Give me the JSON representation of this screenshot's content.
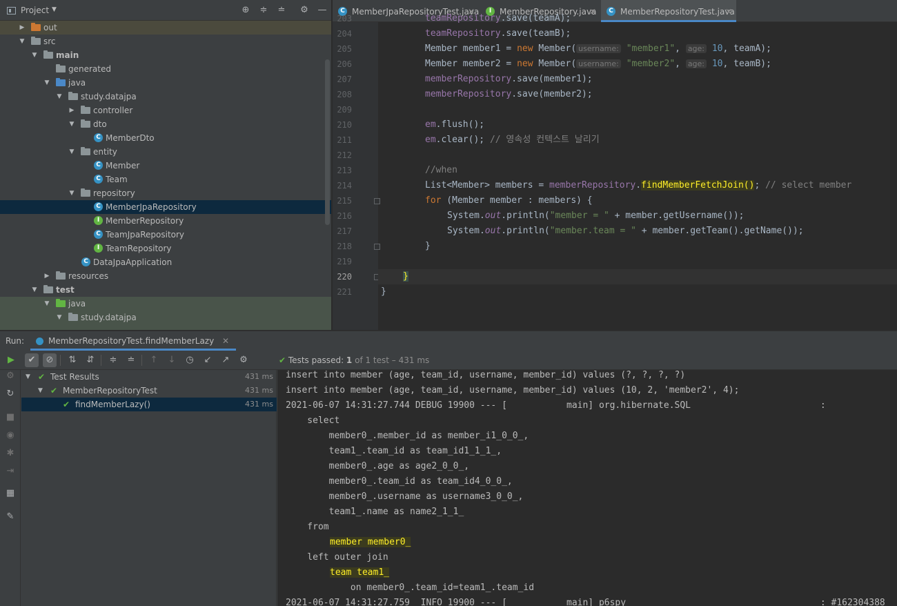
{
  "project_panel": {
    "title": "Project",
    "tree": [
      {
        "label": "out",
        "icon": "folder-orange-icon"
      },
      {
        "label": "src",
        "icon": "folder-icon"
      },
      {
        "label": "main",
        "icon": "folder-icon"
      },
      {
        "label": "generated",
        "icon": "folder-generated-icon"
      },
      {
        "label": "java",
        "icon": "folder-source-icon"
      },
      {
        "label": "study.datajpa",
        "icon": "package-icon"
      },
      {
        "label": "controller",
        "icon": "package-icon"
      },
      {
        "label": "dto",
        "icon": "package-icon"
      },
      {
        "label": "MemberDto",
        "icon": "class-icon"
      },
      {
        "label": "entity",
        "icon": "package-icon"
      },
      {
        "label": "Member",
        "icon": "class-icon"
      },
      {
        "label": "Team",
        "icon": "class-icon"
      },
      {
        "label": "repository",
        "icon": "package-icon"
      },
      {
        "label": "MemberJpaRepository",
        "icon": "class-icon"
      },
      {
        "label": "MemberRepository",
        "icon": "interface-icon"
      },
      {
        "label": "TeamJpaRepository",
        "icon": "class-icon"
      },
      {
        "label": "TeamRepository",
        "icon": "interface-icon"
      },
      {
        "label": "DataJpaApplication",
        "icon": "spring-class-icon"
      },
      {
        "label": "resources",
        "icon": "folder-resources-icon"
      },
      {
        "label": "test",
        "icon": "folder-icon"
      },
      {
        "label": "java",
        "icon": "folder-test-source-icon"
      },
      {
        "label": "study.datajpa",
        "icon": "package-icon"
      }
    ]
  },
  "editor": {
    "tabs": [
      {
        "label": "MemberJpaRepositoryTest.java",
        "icon": "C"
      },
      {
        "label": "MemberRepository.java",
        "icon": "I"
      },
      {
        "label": "MemberRepositoryTest.java",
        "icon": "C"
      }
    ],
    "line_numbers": [
      "203",
      "204",
      "205",
      "206",
      "207",
      "208",
      "209",
      "210",
      "211",
      "212",
      "213",
      "214",
      "215",
      "216",
      "217",
      "218",
      "219",
      "220",
      "221"
    ],
    "code": {
      "l203": [
        "teamRepository",
        ".save(teamA);"
      ],
      "l204": [
        "teamRepository",
        ".save(teamB);"
      ],
      "l205": [
        "Member member1 = ",
        "new",
        " Member(",
        "username:",
        "\"member1\"",
        ", ",
        "age:",
        "10",
        ", teamA);"
      ],
      "l206": [
        "Member member2 = ",
        "new",
        " Member(",
        "username:",
        "\"member2\"",
        ", ",
        "age:",
        "10",
        ", teamB);"
      ],
      "l207": [
        "memberRepository",
        ".save(member1);"
      ],
      "l208": [
        "memberRepository",
        ".save(member2);"
      ],
      "l210": [
        "em",
        ".flush();"
      ],
      "l211": [
        "em",
        ".clear(); ",
        "// 영속성 컨텍스트 날리기"
      ],
      "l213": [
        "//when"
      ],
      "l214": [
        "List<Member> members = ",
        "memberRepository",
        ".",
        "findMemberFetchJoin()",
        "; ",
        "// select member"
      ],
      "l215": [
        "for",
        " (Member member : members) {"
      ],
      "l216": [
        "System.",
        "out",
        ".println(",
        "\"member = \"",
        " + member.getUsername());"
      ],
      "l217": [
        "System.",
        "out",
        ".println(",
        "\"member.team = \"",
        " + member.getTeam().getName());"
      ],
      "l218": [
        "}"
      ],
      "l220": [
        "}"
      ],
      "l221": [
        "}"
      ]
    }
  },
  "run_panel": {
    "label": "Run:",
    "tab": "MemberRepositoryTest.findMemberLazy",
    "status": {
      "prefix": "Tests passed: ",
      "passed": "1",
      "suffix": " of 1 test – 431 ms"
    },
    "results": [
      {
        "label": "Test Results",
        "time": "431 ms"
      },
      {
        "label": "MemberRepositoryTest",
        "time": "431 ms"
      },
      {
        "label": "findMemberLazy()",
        "time": "431 ms"
      }
    ],
    "console": [
      "insert into member (age, team_id, username, member_id) values (?, ?, ?, ?)",
      "insert into member (age, team_id, username, member_id) values (10, 2, 'member2', 4);",
      "2021-06-07 14:31:27.744 DEBUG 19900 --- [           main] org.hibernate.SQL                        :",
      "    select",
      "        member0_.member_id as member_i1_0_0_,",
      "        team1_.team_id as team_id1_1_1_,",
      "        member0_.age as age2_0_0_,",
      "        member0_.team_id as team_id4_0_0_,",
      "        member0_.username as username3_0_0_,",
      "        team1_.name as name2_1_1_",
      "    from",
      "member member0_",
      "    left outer join",
      "team team1_",
      "            on member0_.team_id=team1_.team_id",
      "2021-06-07 14:31:27.759  INFO 19900 --- [           main] p6spy                                    : #162304388"
    ]
  },
  "colors": {
    "accent": "#4a88c7",
    "pass": "#62b543",
    "keyword": "#cc7832",
    "string": "#6a8759",
    "number": "#6897bb",
    "field": "#9876aa",
    "highlight": "#ffef28"
  }
}
